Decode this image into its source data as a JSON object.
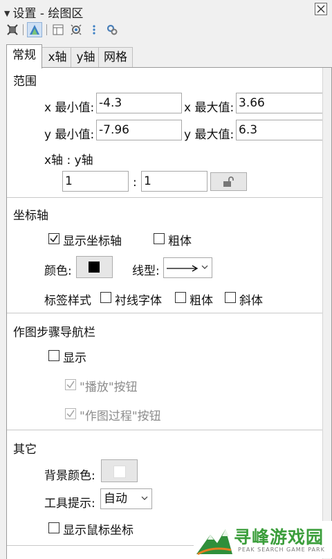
{
  "window": {
    "title": "设置 - 绘图区"
  },
  "toolbar": {
    "icons": [
      "object-props-icon",
      "graphics-icon",
      "layout-icon",
      "defaults-icon",
      "more-icon",
      "advanced-icon"
    ]
  },
  "tabs": [
    "常规",
    "x轴",
    "y轴",
    "网格"
  ],
  "range": {
    "title": "范围",
    "xmin_label": "x 最小值:",
    "xmin_value": "-4.3",
    "xmax_label": "x 最大值:",
    "xmax_value": "3.66",
    "ymin_label": "y 最小值:",
    "ymin_value": "-7.96",
    "ymax_label": "y 最大值:",
    "ymax_value": "6.3",
    "ratio_label": "x轴 : y轴",
    "ratio_x": "1",
    "ratio_sep": ":",
    "ratio_y": "1"
  },
  "axes": {
    "title": "坐标轴",
    "show_axes_label": "显示坐标轴",
    "show_axes_checked": true,
    "bold_label": "粗体",
    "bold_checked": false,
    "color_label": "颜色:",
    "color_value": "#000000",
    "linestyle_label": "线型:",
    "label_style_label": "标签样式",
    "serif_label": "衬线字体",
    "serif_checked": false,
    "label_bold_label": "粗体",
    "label_bold_checked": false,
    "italic_label": "斜体",
    "italic_checked": false
  },
  "navbar": {
    "title": "作图步骤导航栏",
    "show_label": "显示",
    "show_checked": false,
    "play_label": "\"播放\"按钮",
    "play_checked": true,
    "process_label": "\"作图过程\"按钮",
    "process_checked": true
  },
  "other": {
    "title": "其它",
    "bg_label": "背景颜色:",
    "bg_value": "#ffffff",
    "tooltip_label": "工具提示:",
    "tooltip_value": "自动",
    "mouse_coords_label": "显示鼠标坐标",
    "mouse_coords_checked": false
  },
  "watermark": {
    "name": "寻峰游戏园",
    "sub": "PEAK SEARCH GAME PARK"
  }
}
